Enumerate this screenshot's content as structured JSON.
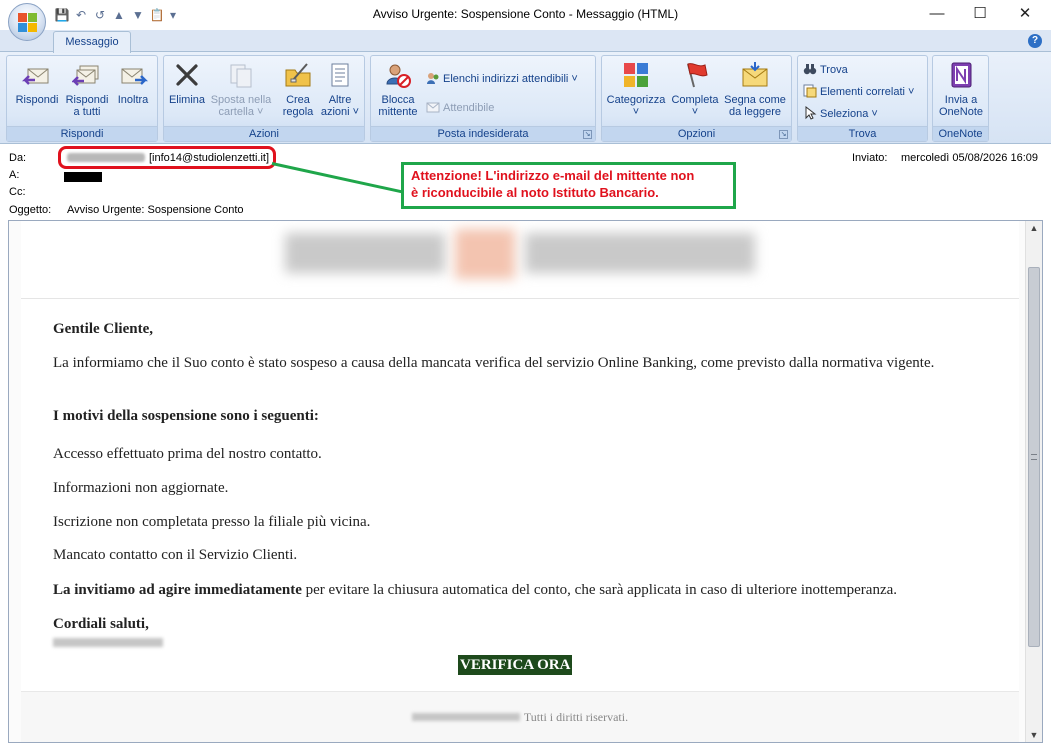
{
  "window": {
    "title": "Avviso Urgente: Sospensione Conto - Messaggio (HTML)",
    "minimize": "—",
    "maximize": "☐",
    "close": "✕"
  },
  "ribbon": {
    "tab": "Messaggio",
    "help": "?",
    "groups": {
      "rispondi": {
        "label": "Rispondi",
        "reply": "Rispondi",
        "reply_all_1": "Rispondi",
        "reply_all_2": "a tutti",
        "forward": "Inoltra"
      },
      "azioni": {
        "label": "Azioni",
        "delete": "Elimina",
        "move_1": "Sposta nella",
        "move_2": "cartella ˅",
        "rule_1": "Crea",
        "rule_2": "regola",
        "other_1": "Altre",
        "other_2": "azioni ˅"
      },
      "posta": {
        "label": "Posta indesiderata",
        "block_1": "Blocca",
        "block_2": "mittente",
        "safe_lists": "Elenchi indirizzi attendibili ˅",
        "safe": "Attendibile"
      },
      "opzioni": {
        "label": "Opzioni",
        "categorize": "Categorizza",
        "categorize_arrow": "˅",
        "flag": "Completa",
        "flag_arrow": "˅",
        "unread_1": "Segna come",
        "unread_2": "da leggere"
      },
      "trova": {
        "label": "Trova",
        "find": "Trova",
        "related": "Elementi correlati ˅",
        "select": "Seleziona ˅"
      },
      "onenote": {
        "label": "OneNote",
        "send_1": "Invia a",
        "send_2": "OneNote"
      }
    },
    "colors": {
      "accent_text": "#15428b",
      "group_bg": "#dce8f7"
    }
  },
  "header": {
    "from_label": "Da:",
    "from_email": "[info14@studiolenzetti.it]",
    "to_label": "A:",
    "cc_label": "Cc:",
    "subject_label": "Oggetto:",
    "subject": "Avviso Urgente: Sospensione Conto",
    "sent_label": "Inviato:",
    "sent_value": "mercoledì 05/08/2026 16:09"
  },
  "annotation": {
    "warning_line1": "Attenzione! L'indirizzo e-mail del mittente non",
    "warning_line2": "è riconducibile al noto Istituto Bancario.",
    "oval_color": "#e0111d",
    "box_color": "#1fa64a"
  },
  "email": {
    "greeting": "Gentile Cliente,",
    "intro": "La informiamo che il Suo conto è stato sospeso a causa della mancata verifica del servizio Online Banking, come previsto dalla normativa vigente.",
    "reasons_title": "I motivi della sospensione sono i seguenti:",
    "reasons": [
      "Accesso effettuato prima del nostro contatto.",
      "Informazioni non aggiornate.",
      "Iscrizione non completata presso la filiale più vicina.",
      "Mancato contatto con il Servizio Clienti."
    ],
    "invite_bold": "La invitiamo ad agire immediatamente",
    "invite_rest": " per evitare la chiusura automatica del conto, che sarà applicata in caso di ulteriore inottemperanza.",
    "closing": "Cordiali saluti,",
    "cta": "VERIFICA ORA",
    "cta_color": "#1e4a1c",
    "footer": "Tutti i diritti riservati."
  }
}
